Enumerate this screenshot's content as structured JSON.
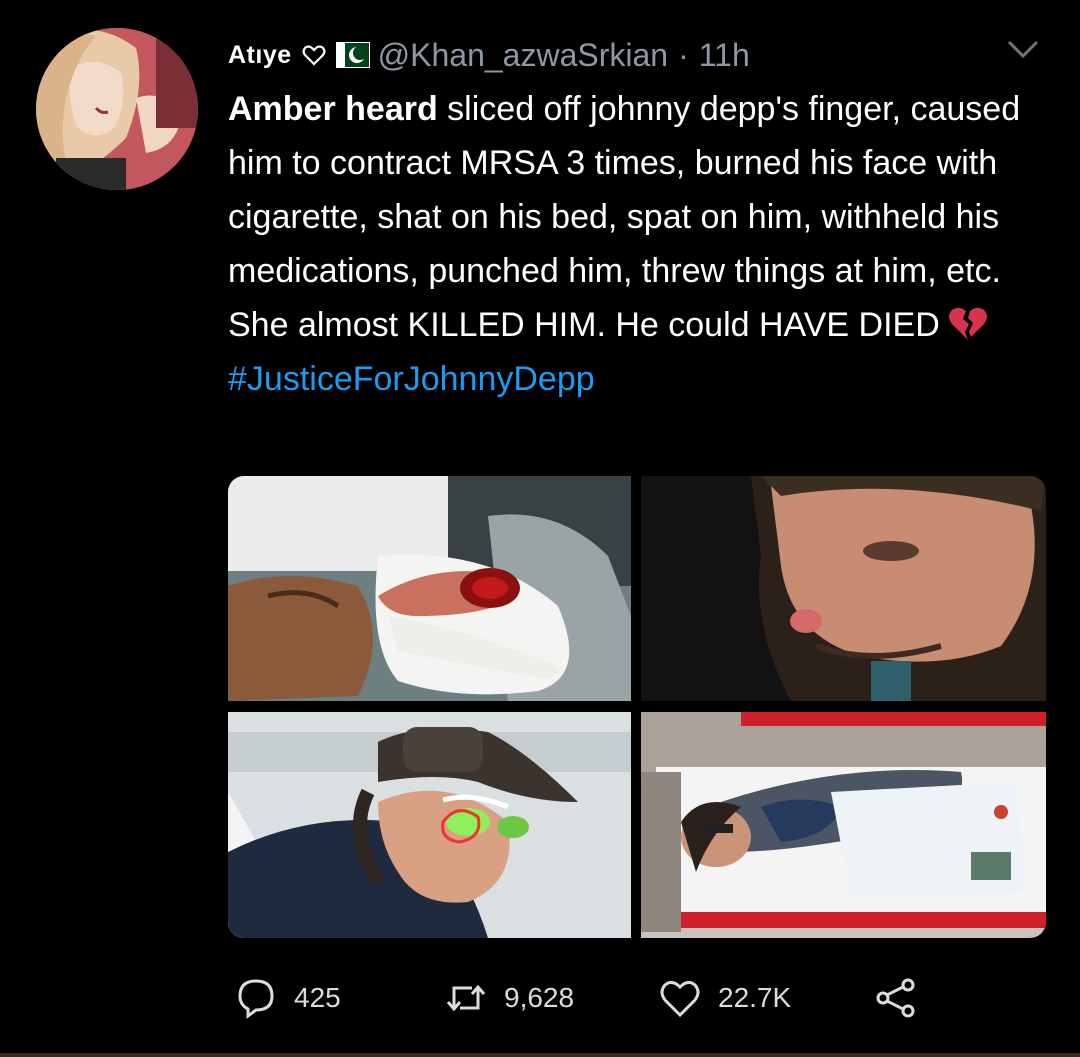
{
  "tweet": {
    "display_name": "Atıye",
    "handle": "@Khan_azwaSrkian",
    "separator": "·",
    "time": "11h",
    "bold_lead": "Amber heard",
    "text_rest": " sliced off johnny depp's finger, caused him to contract MRSA 3 times, burned his face with cigarette, shat on his bed, spat on him, withheld his medications, punched him, threw things at him, etc. She almost KILLED HIM. He could HAVE DIED",
    "hashtag": "#JusticeForJohnnyDepp"
  },
  "stats": {
    "replies": "425",
    "retweets": "9,628",
    "likes": "22.7K"
  },
  "colors": {
    "background": "#000000",
    "muted": "#8b98a5",
    "link": "#1d9bf0",
    "broken_heart": "#d6334c"
  },
  "icons": [
    "heart-outline-icon",
    "pakistan-flag-icon",
    "chevron-down-icon",
    "broken-heart-icon",
    "reply-icon",
    "retweet-icon",
    "like-icon",
    "share-icon"
  ]
}
